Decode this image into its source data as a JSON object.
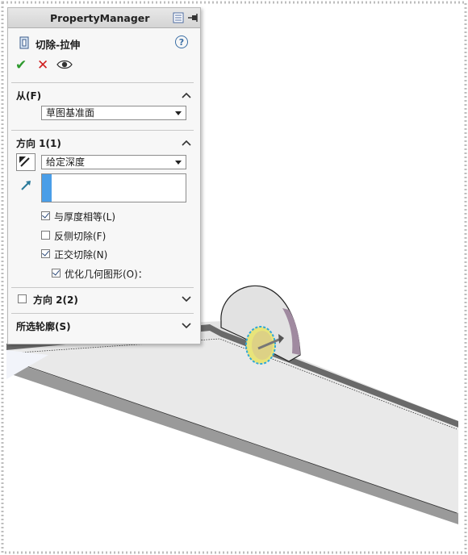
{
  "panel": {
    "title": "PropertyManager",
    "feature_name": "切除-拉伸",
    "help_symbol": "?"
  },
  "actions": {
    "ok_symbol": "✔",
    "cancel_symbol": "✕",
    "preview_symbol": "👁"
  },
  "from_section": {
    "title": "从(F)",
    "selected_value": "草图基准面"
  },
  "direction1": {
    "title": "方向 1(1)",
    "end_condition": "给定深度",
    "depth_value": "",
    "checkboxes": [
      {
        "label": "与厚度相等(L)",
        "checked": true
      },
      {
        "label": "反侧切除(F)",
        "checked": false
      },
      {
        "label": "正交切除(N)",
        "checked": true
      },
      {
        "label": "优化几何图形(O)：",
        "checked": true
      }
    ]
  },
  "direction2": {
    "title": "方向 2(2)",
    "checked": false
  },
  "contours_section": {
    "title": "所选轮廓(S)"
  },
  "colors": {
    "ok_green": "#2e9a2e",
    "cancel_red": "#d02020",
    "accent_blue": "#4a9ee8",
    "part_face": "#e6e6e6",
    "hole_yellow": "#e8e47a"
  }
}
